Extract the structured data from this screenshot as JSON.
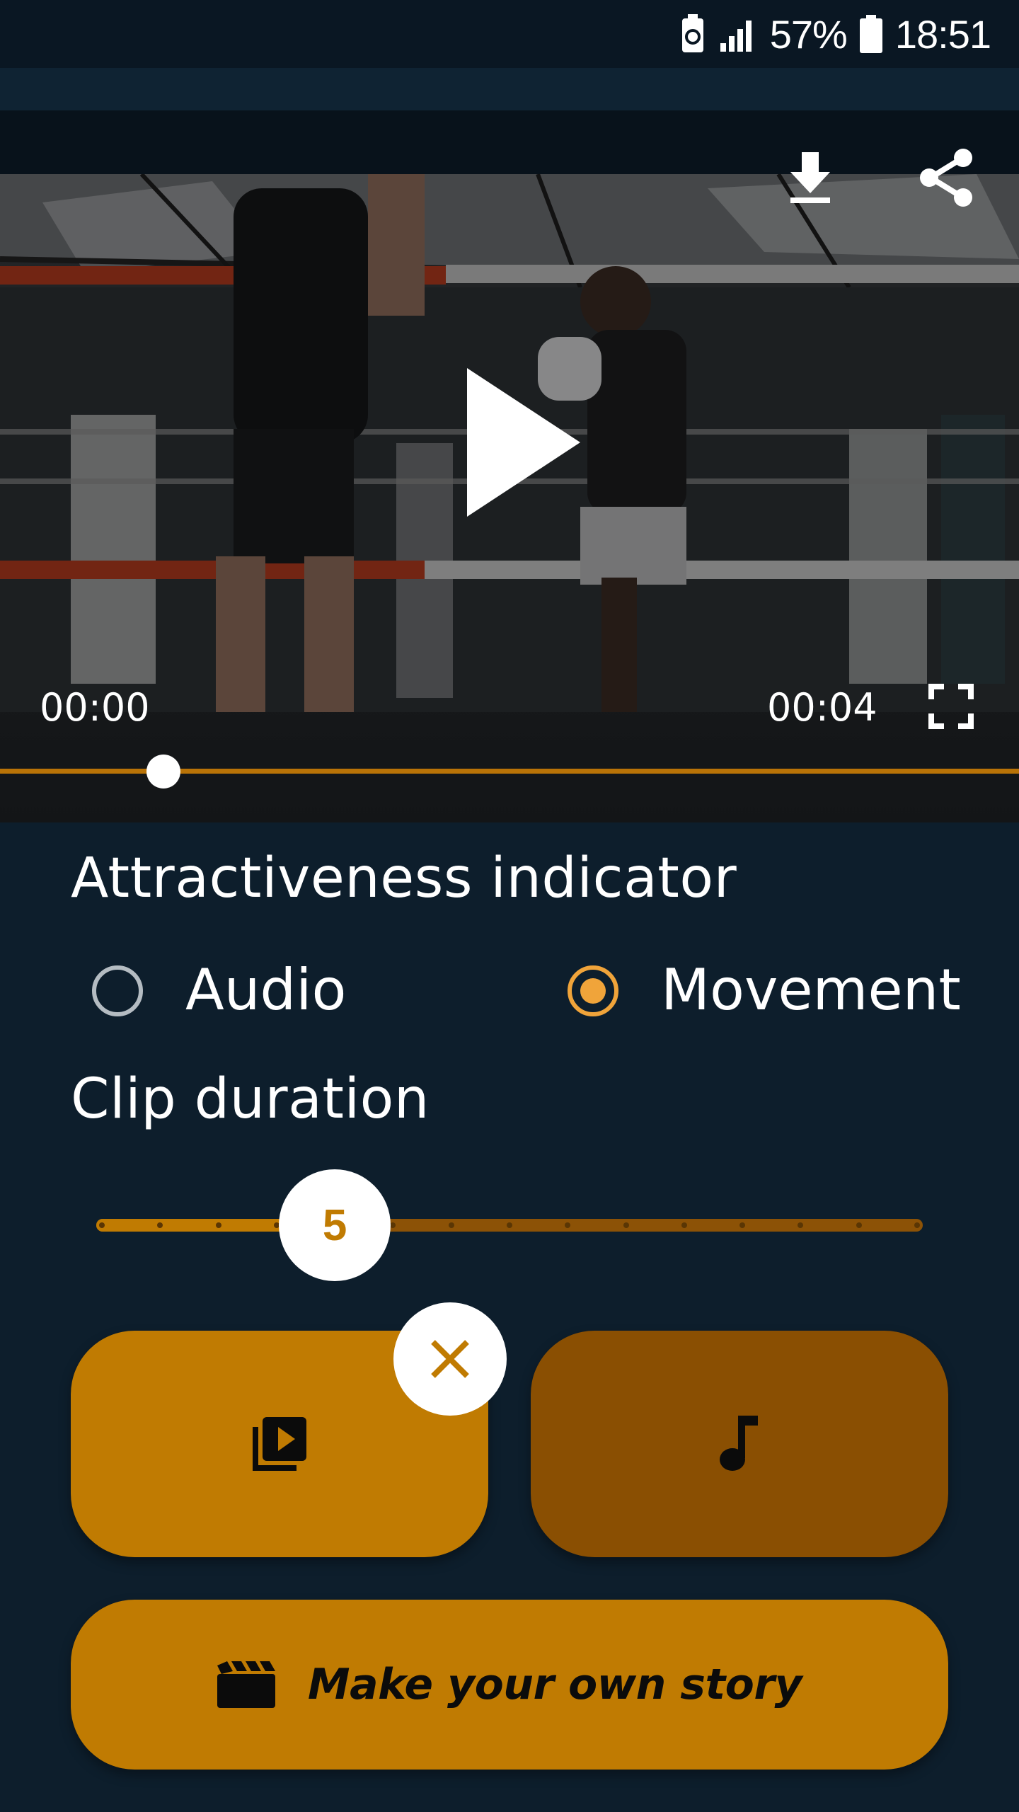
{
  "status_bar": {
    "battery_percent": "57%",
    "time": "18:51",
    "icons": [
      "battery-saver-icon",
      "signal-icon",
      "battery-icon"
    ]
  },
  "video": {
    "current_time": "00:00",
    "duration": "00:04",
    "progress_fraction": 0.0,
    "icons": [
      "download-icon",
      "share-icon",
      "play-icon",
      "fullscreen-icon"
    ]
  },
  "attractiveness": {
    "title": "Attractiveness indicator",
    "options": [
      {
        "label": "Audio",
        "selected": false
      },
      {
        "label": "Movement",
        "selected": true
      }
    ]
  },
  "clip_duration": {
    "title": "Clip duration",
    "value": "5",
    "min": 1,
    "max": 15,
    "steps": 15
  },
  "media_buttons": {
    "video_icon": "video-library-icon",
    "music_icon": "music-note-icon",
    "close_icon": "close-icon"
  },
  "story_button": {
    "label": "Make your own story",
    "icon": "clapperboard-icon"
  },
  "colors": {
    "background": "#0d1e2c",
    "accent": "#c07b02",
    "accent_dark": "#8a4f02",
    "radio_selected": "#f0a43a"
  }
}
